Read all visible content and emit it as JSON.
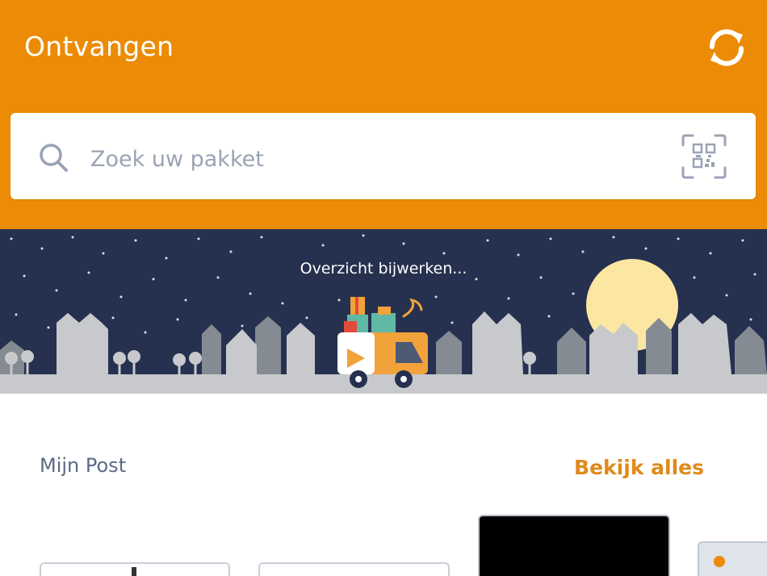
{
  "header": {
    "title": "Ontvangen",
    "refresh_icon": "refresh-icon",
    "background_color": "#ec8b05"
  },
  "search": {
    "placeholder": "Zoek uw pakket",
    "value": "",
    "search_icon": "search-icon",
    "scan_icon": "qr-scan-icon"
  },
  "banner": {
    "status_text": "Overzicht bijwerken...",
    "sky_color": "#263150"
  },
  "my_post": {
    "title": "Mijn Post",
    "view_all_label": "Bekijk alles",
    "accent_color": "#e08a1c"
  }
}
